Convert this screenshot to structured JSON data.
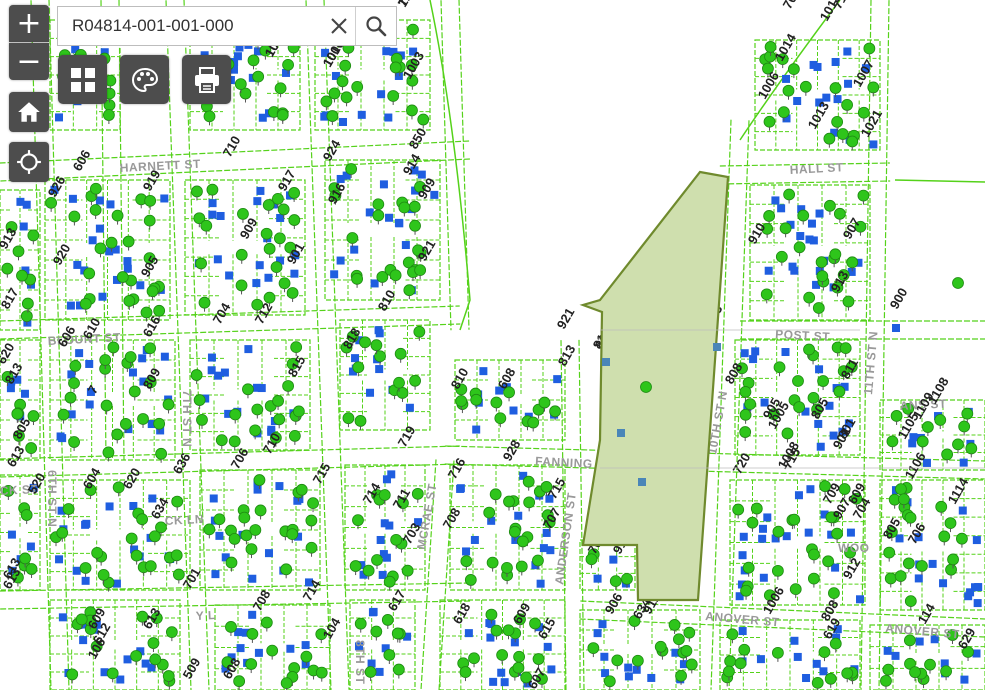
{
  "search": {
    "value": "R04814-001-001-000"
  },
  "controls": {
    "zoom_in": "+",
    "zoom_out": "−"
  },
  "icons": {
    "zoom_in": "plus-icon",
    "zoom_out": "minus-icon",
    "home": "home-icon",
    "locate": "locate-icon",
    "clear": "close-icon",
    "search": "search-icon",
    "basemap": "grid-icon",
    "layers": "palette-icon",
    "print": "print-icon"
  },
  "colors": {
    "parcel_line": "#55d21a",
    "building": "#1f5ee0",
    "tree": "#2ec51b",
    "selected_fill": "#cfdfae",
    "selected_stroke": "#6f8a2d",
    "control_bg": "#4d4d4d"
  },
  "streets": [
    "HARNETT ST",
    "BLOUNT ST",
    "7TH ST N",
    "6TH ST N",
    "CK ST",
    "CK LN",
    "MCRAE ST",
    "FANNING ST",
    "ANDERSON ST",
    "POST ST",
    "10TH ST N",
    "11TH ST N",
    "HALL ST",
    "ANOVER ST",
    "ANOVER ST",
    "WOO",
    "ANS ST",
    "8TH ST",
    "Y L"
  ],
  "addresses": [
    "1013",
    "1009",
    "1006",
    "1003",
    "1014",
    "1013",
    "1007",
    "1006",
    "1013",
    "1021",
    "606",
    "710",
    "924",
    "850",
    "919",
    "926",
    "916",
    "909",
    "917",
    "913",
    "920",
    "905",
    "909",
    "901",
    "921",
    "817",
    "914",
    "704",
    "712",
    "610",
    "616",
    "606",
    "620",
    "813",
    "818",
    "810",
    "815",
    "810",
    "809",
    "7",
    "813",
    "608",
    "613",
    "805",
    "905",
    "921",
    "812",
    "813",
    "910",
    "907",
    "913",
    "900",
    "901",
    "808",
    "906",
    "813",
    "811",
    "1005",
    "1008",
    "1109",
    "1108",
    "1105",
    "720",
    "801",
    "805",
    "1106",
    "1114",
    "719",
    "706",
    "710",
    "620",
    "636",
    "604",
    "520",
    "634",
    "715",
    "714",
    "711",
    "716",
    "708",
    "703",
    "928",
    "715",
    "707",
    "704",
    "709",
    "613",
    "701",
    "708",
    "714",
    "617",
    "618",
    "615",
    "609",
    "808",
    "906",
    "912",
    "1006",
    "619",
    "629",
    "613",
    "609",
    "613",
    "608",
    "612",
    "509",
    "607",
    "906",
    "707",
    "805",
    "706",
    "114",
    "104",
    "106",
    "609",
    "634",
    "914",
    "912",
    "907",
    "715",
    "709",
    "710",
    "719",
    "1013",
    "1017"
  ]
}
